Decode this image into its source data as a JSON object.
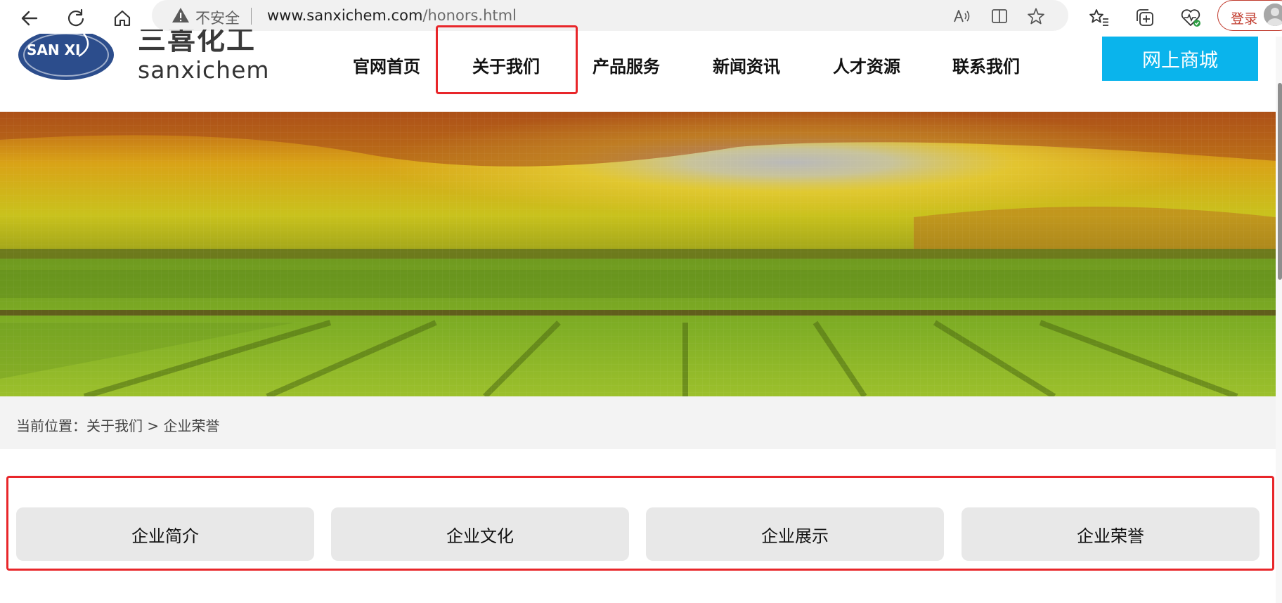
{
  "browser": {
    "security_label": "不安全",
    "url_domain": "www.sanxichem.com",
    "url_path": "/honors.html",
    "login_label": "登录",
    "icons": {
      "back": "back-arrow-icon",
      "refresh": "refresh-icon",
      "home": "home-icon",
      "warning": "warning-icon",
      "read_aloud": "read-aloud-icon",
      "split_screen": "split-screen-icon",
      "favorite": "star-icon",
      "favorites_list": "favorites-icon",
      "collections": "collections-icon",
      "health": "browser-essentials-icon"
    }
  },
  "site": {
    "logo_cn": "三喜化工",
    "logo_en": "sanxichem",
    "logo_badge": "SAN XI",
    "nav": [
      "官网首页",
      "关于我们",
      "产品服务",
      "新闻资讯",
      "人才资源",
      "联系我们"
    ],
    "active_nav": "关于我们",
    "shop_label": "网上商城",
    "accent_color": "#0ab4ec",
    "highlight_color": "#e8262a"
  },
  "breadcrumb": {
    "prefix": "当前位置：",
    "parent": "关于我们",
    "separator": " > ",
    "current": "企业荣誉"
  },
  "subnav": [
    "企业简介",
    "企业文化",
    "企业展示",
    "企业荣誉"
  ]
}
